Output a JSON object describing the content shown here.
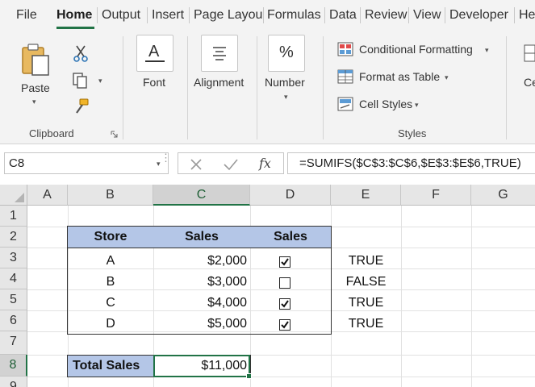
{
  "tabs": [
    "File",
    "Home",
    "Output",
    "Insert",
    "Page Layou",
    "Formulas",
    "Data",
    "Review",
    "View",
    "Developer",
    "He"
  ],
  "ribbon": {
    "clipboard": {
      "paste_label": "Paste",
      "group_label": "Clipboard"
    },
    "font": {
      "label": "Font"
    },
    "alignment": {
      "label": "Alignment"
    },
    "number": {
      "label": "Number",
      "symbol": "%"
    },
    "styles": {
      "conditional_formatting": "Conditional Formatting",
      "format_as_table": "Format as Table",
      "cell_styles": "Cell Styles",
      "group_label": "Styles"
    },
    "cells_partial": "Ce"
  },
  "formula_bar": {
    "name_box": "C8",
    "fx_symbol": "fx",
    "formula": "=SUMIFS($C$3:$C$6,$E$3:$E$6,TRUE)"
  },
  "grid": {
    "columns": [
      "A",
      "B",
      "C",
      "D",
      "E",
      "F",
      "G"
    ],
    "rows": [
      "1",
      "2",
      "3",
      "4",
      "5",
      "6",
      "7",
      "8",
      "9"
    ],
    "table": {
      "headers": [
        "Store",
        "Sales",
        "Sales"
      ],
      "rows": [
        {
          "store": "A",
          "sales": "$2,000",
          "checked": true,
          "flag": "TRUE"
        },
        {
          "store": "B",
          "sales": "$3,000",
          "checked": false,
          "flag": "FALSE"
        },
        {
          "store": "C",
          "sales": "$4,000",
          "checked": true,
          "flag": "TRUE"
        },
        {
          "store": "D",
          "sales": "$5,000",
          "checked": true,
          "flag": "TRUE"
        }
      ]
    },
    "total": {
      "label": "Total Sales",
      "value": "$11,000"
    }
  },
  "colors": {
    "accent": "#217346",
    "header_fill": "#b4c6e7"
  }
}
